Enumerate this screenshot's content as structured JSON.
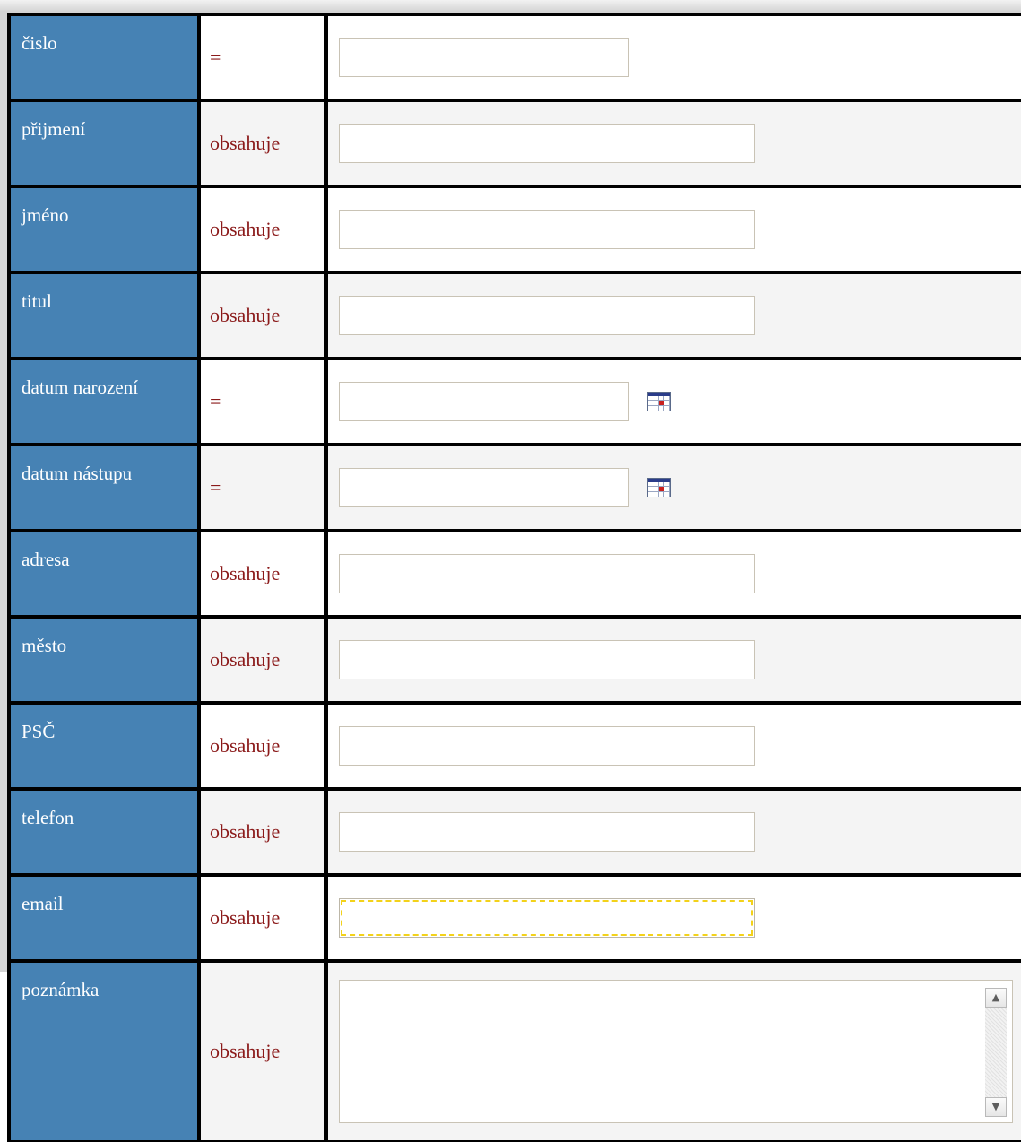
{
  "form": {
    "rows": [
      {
        "label": "čislo",
        "operator": "=",
        "input": {
          "value": "",
          "type": "short",
          "calendar": false,
          "focused": false
        }
      },
      {
        "label": "přijmení",
        "operator": "obsahuje",
        "input": {
          "value": "",
          "type": "long",
          "calendar": false,
          "focused": false
        }
      },
      {
        "label": "jméno",
        "operator": "obsahuje",
        "input": {
          "value": "",
          "type": "long",
          "calendar": false,
          "focused": false
        }
      },
      {
        "label": "titul",
        "operator": "obsahuje",
        "input": {
          "value": "",
          "type": "long",
          "calendar": false,
          "focused": false
        }
      },
      {
        "label": "datum narození",
        "operator": "=",
        "input": {
          "value": "",
          "type": "short",
          "calendar": true,
          "focused": false
        }
      },
      {
        "label": "datum nástupu",
        "operator": "=",
        "input": {
          "value": "",
          "type": "short",
          "calendar": true,
          "focused": false
        }
      },
      {
        "label": "adresa",
        "operator": "obsahuje",
        "input": {
          "value": "",
          "type": "long",
          "calendar": false,
          "focused": false
        }
      },
      {
        "label": "město",
        "operator": "obsahuje",
        "input": {
          "value": "",
          "type": "long",
          "calendar": false,
          "focused": false
        }
      },
      {
        "label": "PSČ",
        "operator": "obsahuje",
        "input": {
          "value": "",
          "type": "long",
          "calendar": false,
          "focused": false
        }
      },
      {
        "label": "telefon",
        "operator": "obsahuje",
        "input": {
          "value": "",
          "type": "long",
          "calendar": false,
          "focused": false
        }
      },
      {
        "label": "email",
        "operator": "obsahuje",
        "input": {
          "value": "",
          "type": "long",
          "calendar": false,
          "focused": true
        }
      }
    ],
    "note_row": {
      "label": "poznámka",
      "operator": "obsahuje",
      "value": ""
    },
    "icons": {
      "calendar": "calendar-icon",
      "scroll_up": "arrow-up-icon",
      "scroll_down": "arrow-down-icon"
    },
    "colors": {
      "label_bg": "#4682b4",
      "label_text": "#ffffff",
      "operator_text": "#8b1a1a",
      "focus_outline": "#f3d21a"
    }
  }
}
